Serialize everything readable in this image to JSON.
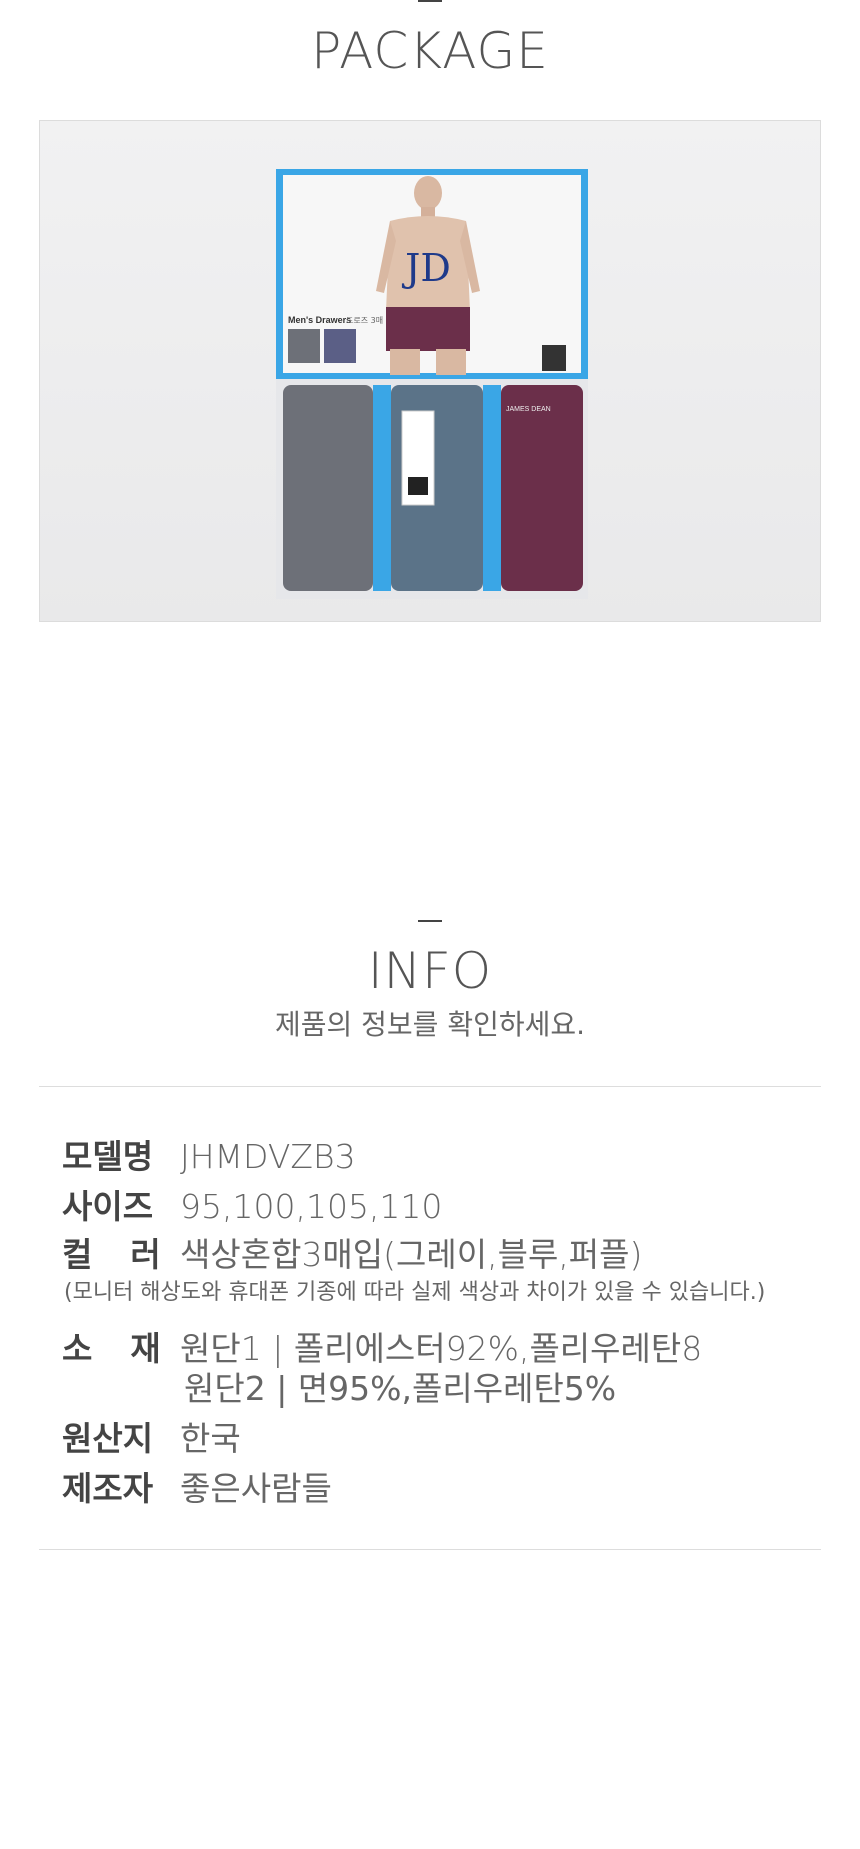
{
  "package": {
    "title": "PACKAGE",
    "box_label": "Men's Drawers",
    "box_sublabel": "드로즈 3매",
    "logo": "JD",
    "brand_tag": "JAMES DEAN"
  },
  "info": {
    "title": "INFO",
    "subtitle": "제품의 정보를 확인하세요.",
    "rows": [
      {
        "label": "모델명",
        "value": "JHMDVZB3"
      },
      {
        "label": "사이즈",
        "value": "95,100,105,110"
      },
      {
        "label": "컬러",
        "value": "색상혼합3매입(그레이,블루,퍼플)"
      },
      {
        "label": "소재",
        "value": "원단1 | 폴리에스터92%,폴리우레탄8"
      },
      {
        "label": "원산지",
        "value": "한국"
      },
      {
        "label": "제조자",
        "value": "좋은사람들"
      }
    ],
    "color_note": "(모니터 해상도와 휴대폰 기종에 따라 실제 색상과 차이가 있을 수 있습니다.)",
    "material_line2": "원단2 | 면95%,폴리우레탄5%"
  },
  "colors": {
    "box_blue": "#3aa6e6",
    "gray_fabric": "#6d7078",
    "blue_fabric": "#5b7388",
    "purple_fabric": "#6b2f4a"
  }
}
